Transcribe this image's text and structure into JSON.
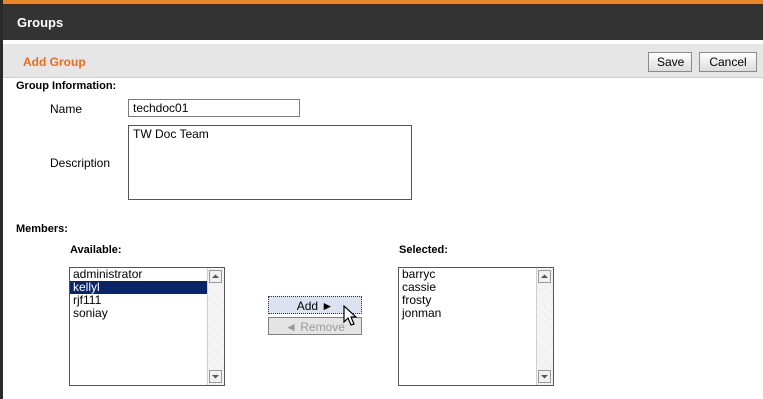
{
  "window": {
    "title": "Groups"
  },
  "page": {
    "title": "Add Group"
  },
  "toolbar": {
    "save_label": "Save",
    "cancel_label": "Cancel"
  },
  "group_info": {
    "heading": "Group Information:",
    "name_label": "Name",
    "name_value": "techdoc01",
    "description_label": "Description",
    "description_value": "TW Doc Team"
  },
  "members": {
    "heading": "Members:",
    "available_label": "Available:",
    "selected_label": "Selected:",
    "available": [
      "administrator",
      "kellyl",
      "rjf111",
      "soniay"
    ],
    "available_selected_index": 1,
    "selected": [
      "barryc",
      "cassie",
      "frosty",
      "jonman"
    ],
    "add_label": "Add ►",
    "remove_label": "◄ Remove"
  },
  "colors": {
    "accent": "#e86c1c",
    "titlebar": "#333333",
    "selection": "#0a246a"
  }
}
